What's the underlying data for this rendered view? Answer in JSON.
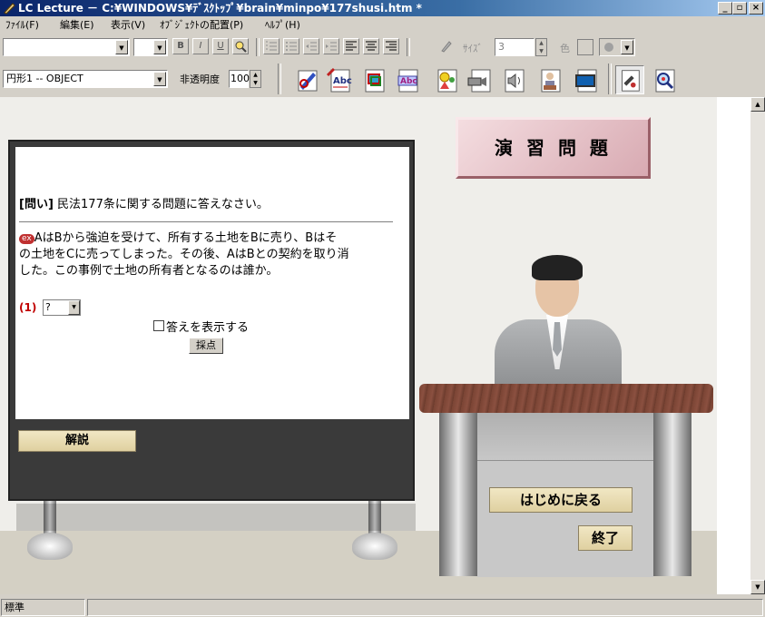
{
  "window": {
    "title": "LC Lecture － C:¥WINDOWS¥ﾃﾞｽｸﾄｯﾌﾟ¥brain¥minpo¥177shusi.htm *",
    "min_label": "_",
    "restore_label": "▫",
    "close_label": "×"
  },
  "menu": {
    "file": "ﾌｧｲﾙ(F)",
    "edit": "編集(E)",
    "view": "表示(V)",
    "object": "ｵﾌﾞｼﾞｪｸﾄの配置(P)",
    "help": "ﾍﾙﾌﾟ(H)"
  },
  "toolbar1": {
    "bold": "B",
    "italic": "I",
    "underline": "U",
    "size_label": "ｻｲｽﾞ",
    "size_value": "3",
    "color_label": "色"
  },
  "toolbar2": {
    "object_select": "円形1 -- OBJECT",
    "opacity_label": "非透明度",
    "opacity_value": "100"
  },
  "lesson": {
    "sign_title": "演 習 問 題",
    "question_label": "[問い]",
    "question_text": " 民法177条に関する問題に答えなさい。",
    "case_badge": "ex",
    "case_line1": "AはBから強迫を受けて、所有する土地をBに売り、Bはそ",
    "case_line2": "の土地をCに売ってしまった。その後、AはBとの契約を取り消",
    "case_line3": "した。この事例で土地の所有者となるのは誰か。",
    "item_number": "(1)",
    "answer_value": "?",
    "show_answer_label": "答えを表示する",
    "grade_button": "採点",
    "explain_button": "解説",
    "back_button": "はじめに戻る",
    "exit_button": "終了"
  },
  "status": {
    "text": "標準"
  }
}
